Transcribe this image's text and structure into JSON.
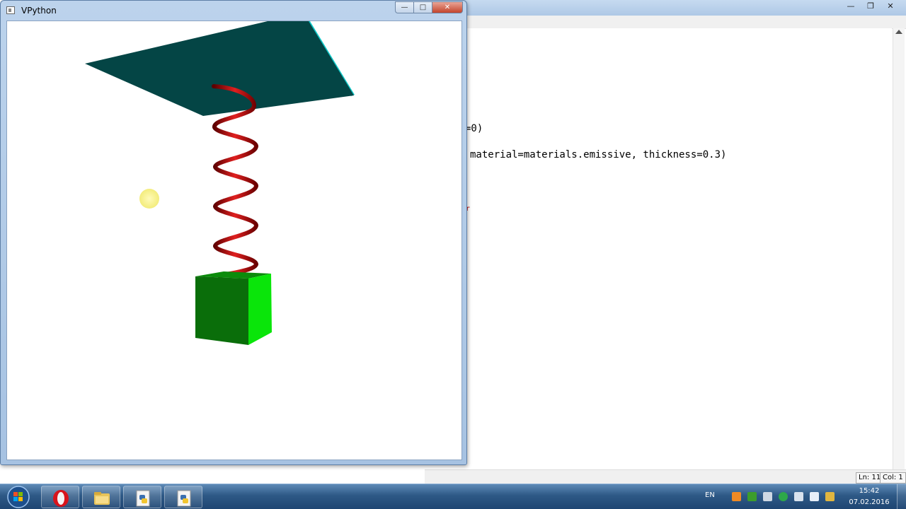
{
  "editor": {
    "controls": [
      "—",
      "❐",
      "✕"
    ],
    "code_lines": [
      "=0)",
      "material=materials.emissive, thickness=0.3)"
    ],
    "marker": "r",
    "status": {
      "line": "Ln: 11",
      "col": "Col: 1"
    }
  },
  "vpython": {
    "title": "VPython",
    "controls": {
      "minimize": "—",
      "maximize": "□",
      "close": "✕"
    },
    "scene": {
      "ceiling_color": "#044545",
      "ceiling_edge_color": "#10c8c8",
      "spring_color": "#c01010",
      "box_colors": [
        "#0b6b0b",
        "#0a9a0a",
        "#0ae50a"
      ],
      "light_marker_color": "#fbf59a"
    }
  },
  "taskbar": {
    "apps": [
      {
        "name": "opera",
        "icon": "opera-icon"
      },
      {
        "name": "explorer",
        "icon": "folder-icon"
      },
      {
        "name": "python-idle",
        "icon": "python-file-icon"
      },
      {
        "name": "vpython",
        "icon": "python-file-icon"
      }
    ],
    "tray": {
      "language": "EN",
      "time": "15:42",
      "date": "07.02.2016"
    }
  }
}
